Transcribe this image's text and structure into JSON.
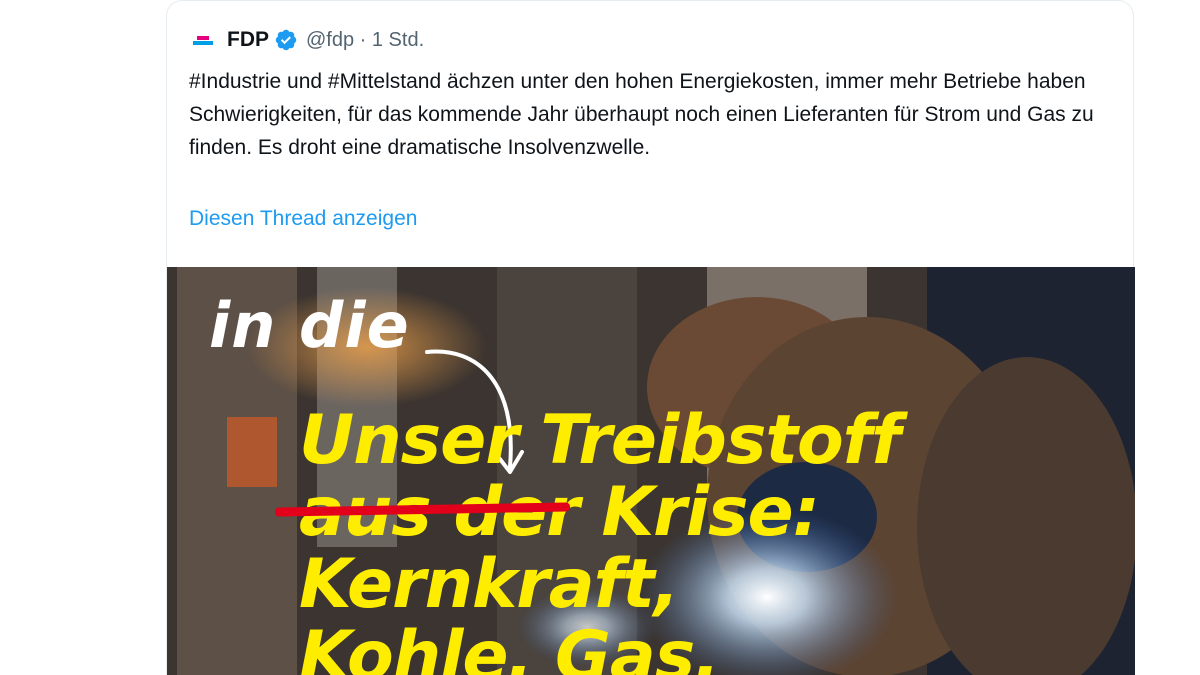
{
  "tweet": {
    "author_name": "FDP",
    "handle_time": "@fdp · 1 Std.",
    "text": "#Industrie und #Mittelstand ächzen unter den hohen Energiekosten, immer mehr Betriebe haben Schwierigkeiten, für das kommende Jahr überhaupt noch einen Lieferanten für Strom und Gas zu finden. Es droht eine dramatische Insolvenzwelle.",
    "thread_link": "Diesen Thread anzeigen"
  },
  "media": {
    "handwritten": "in die",
    "line1": "Unser Treibstoff",
    "line2": "aus der Krise:",
    "line3": "Kernkraft,",
    "line4": "Kohle, Gas."
  },
  "colors": {
    "link": "#1d9bf0",
    "headline_yellow": "#ffed00",
    "strike_red": "#e2001a",
    "verified_blue": "#1d9bf0"
  },
  "icons": {
    "verified": "verified-badge-icon",
    "avatar": "fdp-logo-icon"
  }
}
